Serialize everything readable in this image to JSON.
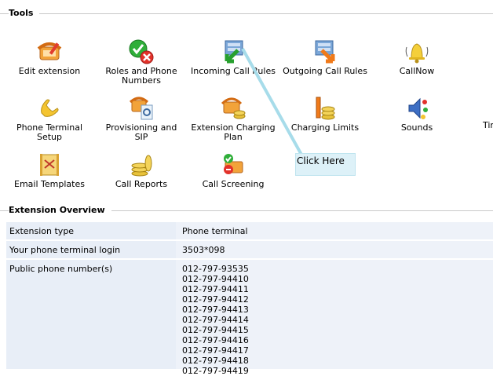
{
  "tools": {
    "title": "Tools",
    "items": [
      {
        "label": "Edit extension",
        "icon": "phone-edit-icon"
      },
      {
        "label": "Roles and Phone\nNumbers",
        "icon": "roles-icon"
      },
      {
        "label": "Incoming Call Rules",
        "icon": "incoming-call-icon"
      },
      {
        "label": "Outgoing Call Rules",
        "icon": "outgoing-call-icon"
      },
      {
        "label": "CallNow",
        "icon": "bell-icon"
      },
      {
        "label": "Phone Terminal Setup",
        "icon": "handset-icon"
      },
      {
        "label": "Provisioning and SIP",
        "icon": "provisioning-icon"
      },
      {
        "label": "Extension Charging\nPlan",
        "icon": "charging-plan-icon"
      },
      {
        "label": "Charging Limits",
        "icon": "charging-limits-icon"
      },
      {
        "label": "Sounds",
        "icon": "sounds-icon"
      },
      {
        "label": "Tim",
        "icon": "partial-icon"
      },
      {
        "label": "Email Templates",
        "icon": "email-template-icon"
      },
      {
        "label": "Call Reports",
        "icon": "coins-icon"
      },
      {
        "label": "Call Screening",
        "icon": "call-screening-icon"
      }
    ]
  },
  "callout": {
    "text": "Click Here"
  },
  "overview": {
    "title": "Extension Overview",
    "rows": [
      {
        "key": "Extension type",
        "value": "Phone terminal"
      },
      {
        "key": "Your phone terminal login",
        "value": "3503*098"
      },
      {
        "key": "Public phone number(s)",
        "values": [
          "012-797-93535",
          "012-797-94410",
          "012-797-94411",
          "012-797-94412",
          "012-797-94413",
          "012-797-94414",
          "012-797-94415",
          "012-797-94416",
          "012-797-94417",
          "012-797-94418",
          "012-797-94419"
        ]
      }
    ]
  }
}
